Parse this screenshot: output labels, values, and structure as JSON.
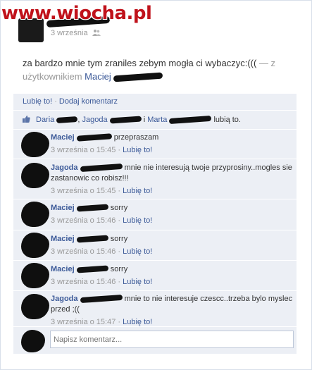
{
  "watermark": "www.wiocha.pl",
  "post": {
    "date": "3 września",
    "text": "za bardzo mnie tym zraniles zebym mogła ci wybaczyc:(((",
    "with_prefix": " — z użytkownikiem ",
    "tagged_user": "Maciej"
  },
  "ufi": {
    "like_label": "Lubię to!",
    "separator": "·",
    "comment_label": "Dodaj komentarz",
    "likes": {
      "names": [
        "Daria",
        "Jagoda",
        "Marta"
      ],
      "sep1": ",",
      "sep2": " i ",
      "suffix": " lubią to."
    },
    "comments": [
      {
        "name": "Maciej",
        "text": "przepraszam",
        "time": "3 września o 15:45",
        "like": "Lubię to!"
      },
      {
        "name": "Jagoda",
        "text": "mnie nie interesują twoje przyprosiny..mogles sie zastanowic co robisz!!!",
        "time": "3 września o 15:45",
        "like": "Lubię to!"
      },
      {
        "name": "Maciej",
        "text": "sorry",
        "time": "3 września o 15:46",
        "like": "Lubię to!"
      },
      {
        "name": "Maciej",
        "text": "sorry",
        "time": "3 września o 15:46",
        "like": "Lubię to!"
      },
      {
        "name": "Maciej",
        "text": "sorry",
        "time": "3 września o 15:46",
        "like": "Lubię to!"
      },
      {
        "name": "Jagoda",
        "text": "mnie to nie interesuje czescc..trzeba bylo myslec przed ;((",
        "time": "3 września o 15:47",
        "like": "Lubię to!"
      }
    ],
    "input": {
      "placeholder": "Napisz komentarz..."
    }
  },
  "meta_sep": " · "
}
